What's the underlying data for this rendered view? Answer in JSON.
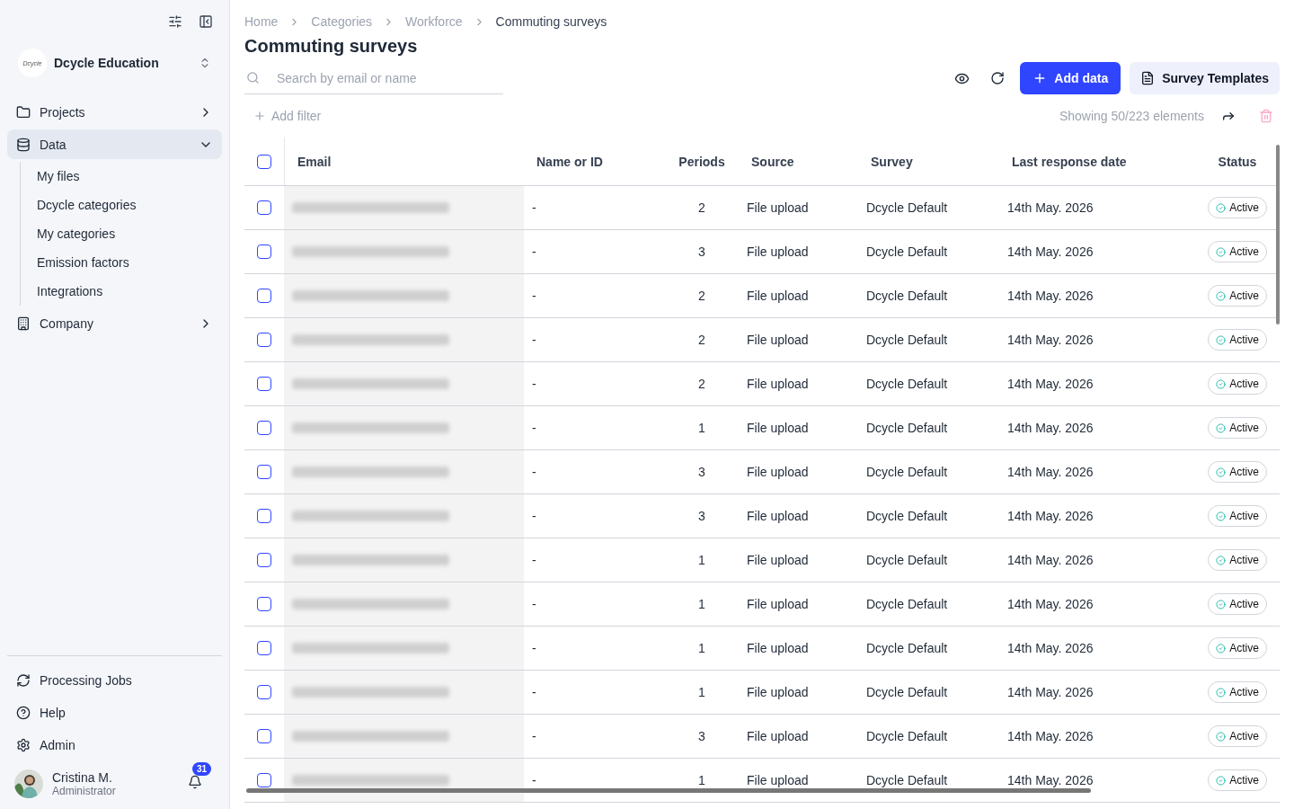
{
  "sidebar": {
    "org": {
      "logo": "Dcycle",
      "name": "Dcycle Education"
    },
    "nav": [
      {
        "label": "Projects",
        "expanded": false,
        "selected": false
      },
      {
        "label": "Data",
        "expanded": true,
        "selected": true,
        "children": [
          {
            "label": "My files"
          },
          {
            "label": "Dcycle categories"
          },
          {
            "label": "My categories"
          },
          {
            "label": "Emission factors"
          },
          {
            "label": "Integrations"
          }
        ]
      },
      {
        "label": "Company",
        "expanded": false,
        "selected": false
      }
    ],
    "footer": [
      {
        "label": "Processing Jobs"
      },
      {
        "label": "Help"
      },
      {
        "label": "Admin"
      }
    ],
    "user": {
      "name": "Cristina M.",
      "role": "Administrator",
      "notifications": "31"
    }
  },
  "breadcrumbs": [
    "Home",
    "Categories",
    "Workforce",
    "Commuting surveys"
  ],
  "title": "Commuting surveys",
  "search": {
    "placeholder": "Search by email or name"
  },
  "buttons": {
    "add": "Add data",
    "templates": "Survey Templates"
  },
  "add_filter": "Add filter",
  "showing": "Showing 50/223 elements",
  "table": {
    "select_all_checked": false,
    "columns": [
      "Email",
      "Name or ID",
      "Periods",
      "Source",
      "Survey",
      "Last response date",
      "Status"
    ],
    "rows": [
      {
        "checked": false,
        "name": "-",
        "periods": "2",
        "source": "File upload",
        "survey": "Dcycle Default",
        "date": "14th May. 2026",
        "status": "Active"
      },
      {
        "checked": false,
        "name": "-",
        "periods": "3",
        "source": "File upload",
        "survey": "Dcycle Default",
        "date": "14th May. 2026",
        "status": "Active"
      },
      {
        "checked": false,
        "name": "-",
        "periods": "2",
        "source": "File upload",
        "survey": "Dcycle Default",
        "date": "14th May. 2026",
        "status": "Active"
      },
      {
        "checked": false,
        "name": "-",
        "periods": "2",
        "source": "File upload",
        "survey": "Dcycle Default",
        "date": "14th May. 2026",
        "status": "Active"
      },
      {
        "checked": false,
        "name": "-",
        "periods": "2",
        "source": "File upload",
        "survey": "Dcycle Default",
        "date": "14th May. 2026",
        "status": "Active"
      },
      {
        "checked": false,
        "name": "-",
        "periods": "1",
        "source": "File upload",
        "survey": "Dcycle Default",
        "date": "14th May. 2026",
        "status": "Active"
      },
      {
        "checked": false,
        "name": "-",
        "periods": "3",
        "source": "File upload",
        "survey": "Dcycle Default",
        "date": "14th May. 2026",
        "status": "Active"
      },
      {
        "checked": false,
        "name": "-",
        "periods": "3",
        "source": "File upload",
        "survey": "Dcycle Default",
        "date": "14th May. 2026",
        "status": "Active"
      },
      {
        "checked": false,
        "name": "-",
        "periods": "1",
        "source": "File upload",
        "survey": "Dcycle Default",
        "date": "14th May. 2026",
        "status": "Active"
      },
      {
        "checked": false,
        "name": "-",
        "periods": "1",
        "source": "File upload",
        "survey": "Dcycle Default",
        "date": "14th May. 2026",
        "status": "Active"
      },
      {
        "checked": false,
        "name": "-",
        "periods": "1",
        "source": "File upload",
        "survey": "Dcycle Default",
        "date": "14th May. 2026",
        "status": "Active"
      },
      {
        "checked": false,
        "name": "-",
        "periods": "1",
        "source": "File upload",
        "survey": "Dcycle Default",
        "date": "14th May. 2026",
        "status": "Active"
      },
      {
        "checked": false,
        "name": "-",
        "periods": "3",
        "source": "File upload",
        "survey": "Dcycle Default",
        "date": "14th May. 2026",
        "status": "Active"
      },
      {
        "checked": false,
        "name": "-",
        "periods": "1",
        "source": "File upload",
        "survey": "Dcycle Default",
        "date": "14th May. 2026",
        "status": "Active"
      }
    ]
  }
}
